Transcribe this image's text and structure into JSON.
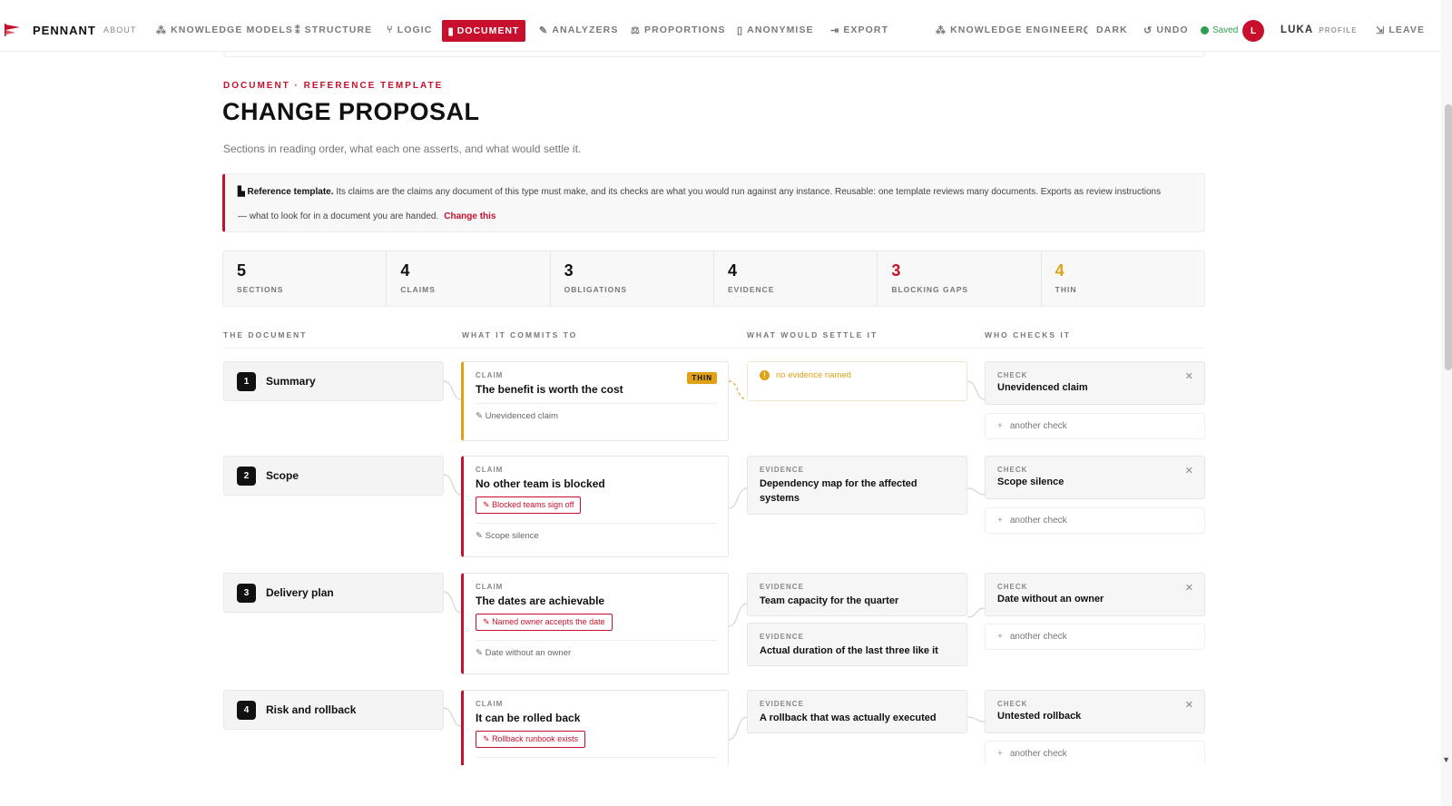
{
  "topbar": {
    "brand": "PENNANT",
    "about": "ABOUT",
    "nav": [
      {
        "label": "KNOWLEDGE MODELS",
        "icon": "network-icon"
      },
      {
        "label": "STRUCTURE",
        "icon": "structure-icon"
      },
      {
        "label": "LOGIC",
        "icon": "branch-icon"
      },
      {
        "label": "DOCUMENT",
        "icon": "document-icon",
        "active": true
      },
      {
        "label": "ANALYZERS",
        "icon": "pencil-icon"
      },
      {
        "label": "PROPORTIONS",
        "icon": "scale-icon"
      },
      {
        "label": "ANONYMISE",
        "icon": "lock-icon"
      },
      {
        "label": "EXPORT",
        "icon": "export-icon"
      }
    ],
    "knowledge_engineer": "KNOWLEDGE ENGINEER",
    "dark": "DARK",
    "undo": "UNDO",
    "saved": "Saved",
    "avatar_initial": "L",
    "user": "LUKA",
    "profile": "PROFILE",
    "leave": "LEAVE",
    "accent": "#c8102e"
  },
  "page": {
    "eyebrow": "DOCUMENT · REFERENCE TEMPLATE",
    "title": "CHANGE PROPOSAL",
    "subtitle": "Sections in reading order, what each one asserts, and what would settle it."
  },
  "notice": {
    "lead": "Reference template.",
    "line1": "Its claims are the claims any document of this type must make, and its checks are what you would run against any instance. Reusable: one template reviews many documents. Exports as review instructions",
    "line2": "— what to look for in a document you are handed.",
    "link": "Change this"
  },
  "stats": [
    {
      "value": "5",
      "label": "SECTIONS",
      "tone": "default"
    },
    {
      "value": "4",
      "label": "CLAIMS",
      "tone": "default"
    },
    {
      "value": "3",
      "label": "OBLIGATIONS",
      "tone": "default"
    },
    {
      "value": "4",
      "label": "EVIDENCE",
      "tone": "default"
    },
    {
      "value": "3",
      "label": "BLOCKING GAPS",
      "tone": "red"
    },
    {
      "value": "4",
      "label": "THIN",
      "tone": "amber"
    }
  ],
  "columns": {
    "document": "THE DOCUMENT",
    "commits": "WHAT IT COMMITS TO",
    "settle": "WHAT WOULD SETTLE IT",
    "checks": "WHO CHECKS IT"
  },
  "labels": {
    "claim": "CLAIM",
    "evidence": "EVIDENCE",
    "check": "CHECK",
    "thin": "THIN",
    "no_evidence": "no evidence named",
    "another_check": "another check"
  },
  "sections": [
    {
      "num": "1",
      "title": "Summary",
      "claim": "The benefit is worth the cost",
      "thin": true,
      "obligation": "",
      "claim_check": "Unevidenced claim",
      "evidence": [],
      "check": "Unevidenced claim"
    },
    {
      "num": "2",
      "title": "Scope",
      "claim": "No other team is blocked",
      "thin": false,
      "obligation": "Blocked teams sign off",
      "claim_check": "Scope silence",
      "evidence": [
        "Dependency map for the affected systems"
      ],
      "check": "Scope silence"
    },
    {
      "num": "3",
      "title": "Delivery plan",
      "claim": "The dates are achievable",
      "thin": false,
      "obligation": "Named owner accepts the date",
      "claim_check": "Date without an owner",
      "evidence": [
        "Team capacity for the quarter",
        "Actual duration of the last three like it"
      ],
      "check": "Date without an owner"
    },
    {
      "num": "4",
      "title": "Risk and rollback",
      "claim": "It can be rolled back",
      "thin": false,
      "obligation": "Rollback runbook exists",
      "claim_check": "",
      "evidence": [
        "A rollback that was actually executed"
      ],
      "check": "Untested rollback"
    }
  ]
}
